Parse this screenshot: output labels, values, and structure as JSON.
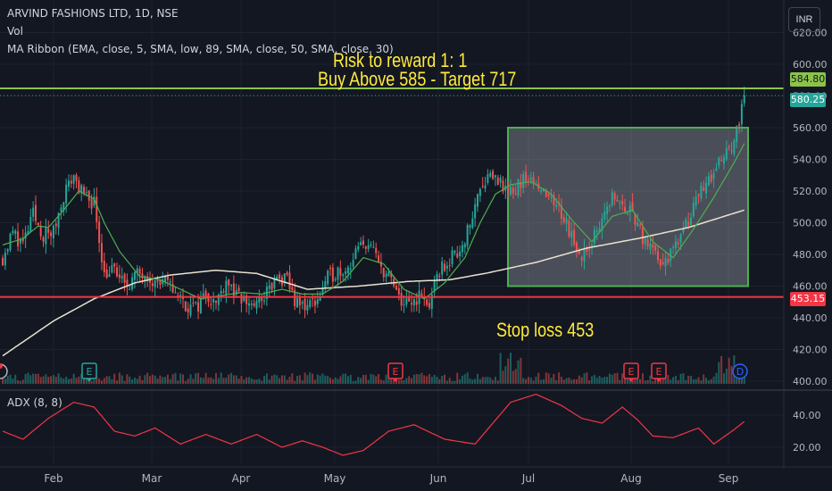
{
  "header": {
    "symbol_line": "ARVIND FASHIONS LTD, 1D, NSE",
    "vol_label": "Vol",
    "ma_label": "MA Ribbon (EMA, close, 5, SMA, low, 89, SMA, close, 50, SMA, close, 30)",
    "currency_button": "INR"
  },
  "annotations": {
    "risk_reward": "Risk to reward  1: 1",
    "buy_target": "Buy Above 585 - Target 717",
    "stop_loss": "Stop loss 453"
  },
  "price_tags": {
    "target_line": "584.80",
    "last_price": "580.25",
    "stop_line": "453.15"
  },
  "adx_label": "ADX (8, 8)",
  "colors": {
    "background": "#131722",
    "up": "#26a69a",
    "down": "#ef5350",
    "annotation": "#ffeb3b",
    "target_line": "#8bc34a",
    "stop_line": "#f23645",
    "adx": "#f23645",
    "box_border": "#4caf50",
    "ma_fast": "#4caf50",
    "ma_slow": "#e8e3d0"
  },
  "chart_data": {
    "type": "candlestick",
    "title": "ARVIND FASHIONS LTD, 1D, NSE",
    "price_axis": {
      "ticks": [
        620,
        600,
        580,
        560,
        540,
        520,
        500,
        480,
        460,
        440,
        420,
        400
      ],
      "ylim": [
        400,
        625
      ]
    },
    "adx_axis": {
      "ticks": [
        40,
        20
      ]
    },
    "x_axis": {
      "months": [
        "Feb",
        "Mar",
        "Apr",
        "May",
        "Jun",
        "Jul",
        "Aug",
        "Sep"
      ]
    },
    "horizontal_lines": [
      {
        "value": 584.8,
        "label": "584.80"
      },
      {
        "value": 453.15,
        "label": "453.15"
      }
    ],
    "consolidation_box": {
      "high": 560,
      "low": 460,
      "start": "Jun 23",
      "end": "Sep 3"
    },
    "last_price": 580.25,
    "events": [
      {
        "month_pos": "Feb",
        "kind": "E"
      },
      {
        "month_pos": "May",
        "kind": "E"
      },
      {
        "month_pos": "Jul",
        "kind": "E"
      },
      {
        "month_pos": "Aug",
        "kind": "E"
      },
      {
        "month_pos": "Aug",
        "kind": "D"
      },
      {
        "month_pos": "Sep",
        "kind": "flash"
      }
    ],
    "price_anchors": [
      [
        0,
        478
      ],
      [
        4,
        494
      ],
      [
        8,
        486
      ],
      [
        12,
        505
      ],
      [
        16,
        492
      ],
      [
        20,
        494
      ],
      [
        24,
        518
      ],
      [
        28,
        530
      ],
      [
        32,
        516
      ],
      [
        36,
        513
      ],
      [
        40,
        468
      ],
      [
        44,
        470
      ],
      [
        48,
        460
      ],
      [
        52,
        466
      ],
      [
        56,
        470
      ],
      [
        60,
        462
      ],
      [
        64,
        462
      ],
      [
        68,
        457
      ],
      [
        72,
        448
      ],
      [
        76,
        446
      ],
      [
        80,
        456
      ],
      [
        84,
        449
      ],
      [
        88,
        465
      ],
      [
        92,
        453
      ],
      [
        96,
        450
      ],
      [
        100,
        448
      ],
      [
        104,
        456
      ],
      [
        108,
        464
      ],
      [
        112,
        463
      ],
      [
        116,
        448
      ],
      [
        120,
        448
      ],
      [
        124,
        452
      ],
      [
        128,
        465
      ],
      [
        132,
        470
      ],
      [
        136,
        472
      ],
      [
        140,
        483
      ],
      [
        144,
        488
      ],
      [
        148,
        474
      ],
      [
        152,
        466
      ],
      [
        156,
        452
      ],
      [
        160,
        447
      ],
      [
        164,
        454
      ],
      [
        168,
        448
      ],
      [
        172,
        470
      ],
      [
        176,
        476
      ],
      [
        180,
        484
      ],
      [
        184,
        498
      ],
      [
        188,
        524
      ],
      [
        192,
        532
      ],
      [
        196,
        525
      ],
      [
        200,
        520
      ],
      [
        204,
        525
      ],
      [
        208,
        531
      ],
      [
        212,
        522
      ],
      [
        216,
        514
      ],
      [
        220,
        505
      ],
      [
        224,
        492
      ],
      [
        228,
        478
      ],
      [
        232,
        490
      ],
      [
        236,
        502
      ],
      [
        240,
        515
      ],
      [
        244,
        512
      ],
      [
        248,
        505
      ],
      [
        252,
        490
      ],
      [
        256,
        480
      ],
      [
        260,
        473
      ],
      [
        264,
        482
      ],
      [
        268,
        497
      ],
      [
        272,
        509
      ],
      [
        276,
        522
      ],
      [
        280,
        533
      ],
      [
        284,
        540
      ],
      [
        288,
        553
      ],
      [
        290,
        566
      ],
      [
        292,
        581
      ]
    ],
    "ma_fast_anchors": [
      [
        0,
        486
      ],
      [
        8,
        490
      ],
      [
        14,
        498
      ],
      [
        18,
        497
      ],
      [
        24,
        508
      ],
      [
        30,
        520
      ],
      [
        36,
        515
      ],
      [
        40,
        500
      ],
      [
        46,
        482
      ],
      [
        54,
        466
      ],
      [
        62,
        464
      ],
      [
        70,
        458
      ],
      [
        78,
        452
      ],
      [
        86,
        454
      ],
      [
        94,
        456
      ],
      [
        102,
        455
      ],
      [
        110,
        458
      ],
      [
        118,
        455
      ],
      [
        126,
        455
      ],
      [
        134,
        463
      ],
      [
        142,
        478
      ],
      [
        150,
        474
      ],
      [
        158,
        458
      ],
      [
        166,
        452
      ],
      [
        174,
        462
      ],
      [
        182,
        478
      ],
      [
        188,
        500
      ],
      [
        194,
        518
      ],
      [
        200,
        524
      ],
      [
        208,
        526
      ],
      [
        216,
        518
      ],
      [
        224,
        502
      ],
      [
        232,
        488
      ],
      [
        240,
        504
      ],
      [
        248,
        508
      ],
      [
        256,
        488
      ],
      [
        264,
        478
      ],
      [
        272,
        496
      ],
      [
        280,
        516
      ],
      [
        288,
        538
      ],
      [
        292,
        550
      ]
    ],
    "ma_slow_anchors": [
      [
        0,
        416
      ],
      [
        20,
        438
      ],
      [
        36,
        452
      ],
      [
        52,
        462
      ],
      [
        66,
        467
      ],
      [
        84,
        470
      ],
      [
        100,
        468
      ],
      [
        120,
        458
      ],
      [
        140,
        460
      ],
      [
        160,
        463
      ],
      [
        176,
        464
      ],
      [
        190,
        468
      ],
      [
        210,
        475
      ],
      [
        230,
        484
      ],
      [
        250,
        490
      ],
      [
        270,
        497
      ],
      [
        292,
        508
      ]
    ],
    "adx_anchors": [
      [
        0,
        30
      ],
      [
        8,
        25
      ],
      [
        18,
        38
      ],
      [
        28,
        48
      ],
      [
        36,
        45
      ],
      [
        44,
        30
      ],
      [
        52,
        27
      ],
      [
        60,
        32
      ],
      [
        70,
        22
      ],
      [
        80,
        28
      ],
      [
        90,
        22
      ],
      [
        100,
        28
      ],
      [
        110,
        20
      ],
      [
        118,
        24
      ],
      [
        126,
        20
      ],
      [
        134,
        15
      ],
      [
        142,
        18
      ],
      [
        152,
        30
      ],
      [
        162,
        34
      ],
      [
        174,
        25
      ],
      [
        186,
        22
      ],
      [
        200,
        48
      ],
      [
        210,
        53
      ],
      [
        220,
        46
      ],
      [
        228,
        38
      ],
      [
        236,
        35
      ],
      [
        244,
        45
      ],
      [
        250,
        37
      ],
      [
        256,
        27
      ],
      [
        264,
        26
      ],
      [
        274,
        32
      ],
      [
        280,
        22
      ],
      [
        288,
        31
      ],
      [
        292,
        36
      ]
    ]
  }
}
